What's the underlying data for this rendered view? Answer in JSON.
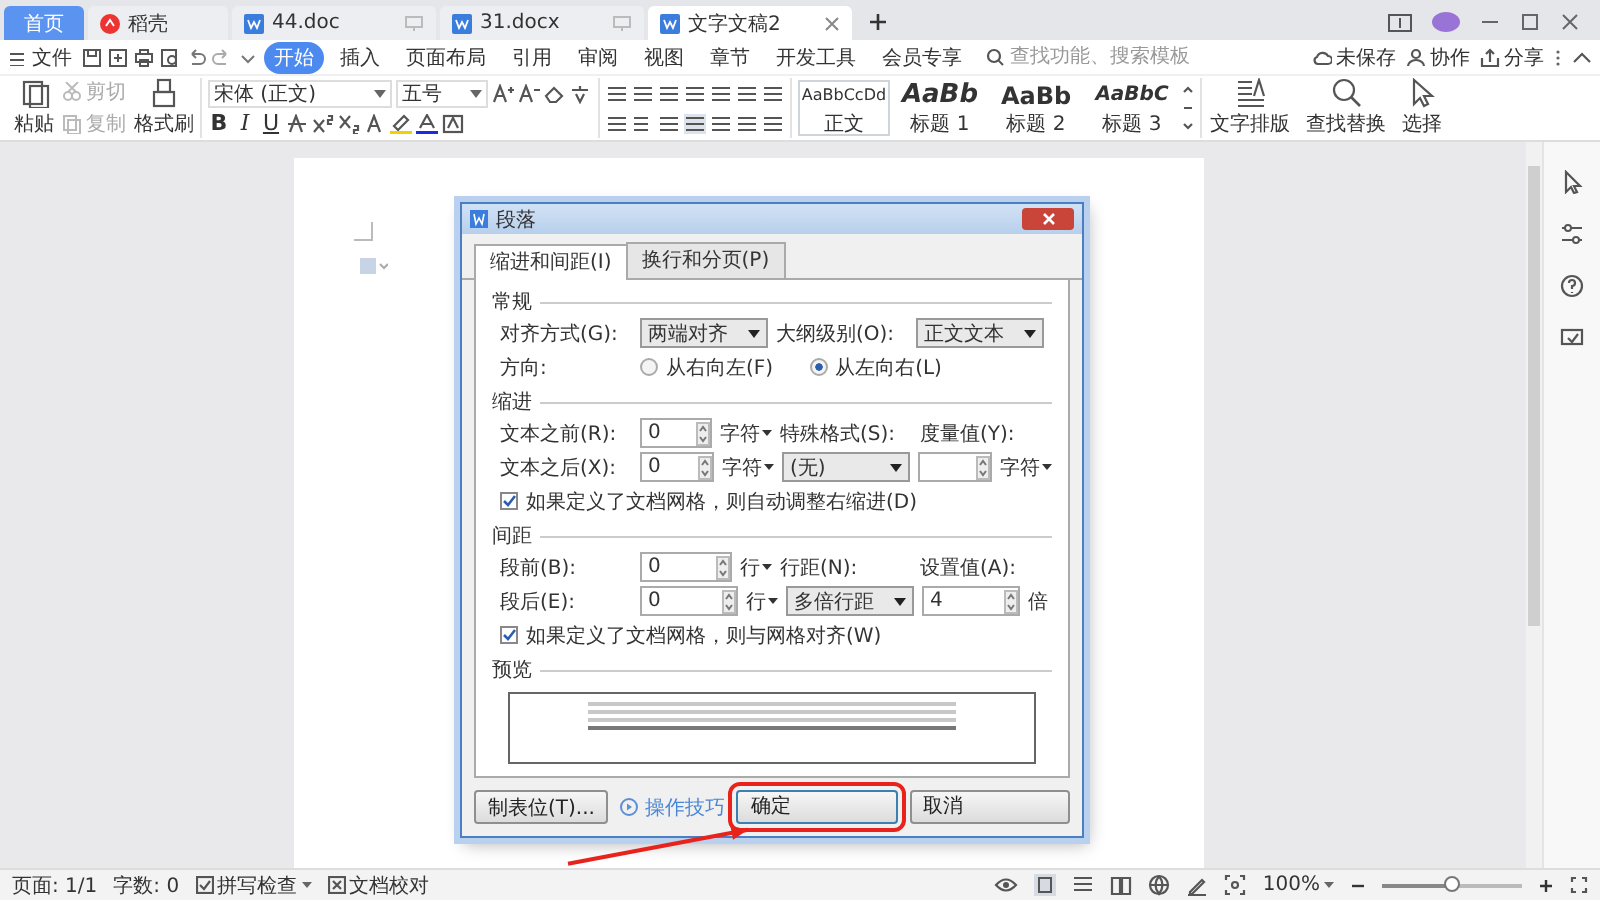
{
  "tab_bar": {
    "tabs": [
      {
        "label": "首页",
        "kind": "home",
        "selected": false
      },
      {
        "label": "稻壳",
        "kind": "docer",
        "selected": false
      },
      {
        "label": "44.doc",
        "kind": "doc",
        "selected": false
      },
      {
        "label": "31.docx",
        "kind": "doc",
        "selected": false
      },
      {
        "label": "文字文稿2",
        "kind": "doc",
        "selected": true
      }
    ]
  },
  "menu_bar": {
    "file": "文件",
    "tabs": [
      {
        "label": "开始",
        "selected": true
      },
      {
        "label": "插入",
        "selected": false
      },
      {
        "label": "页面布局",
        "selected": false
      },
      {
        "label": "引用",
        "selected": false
      },
      {
        "label": "审阅",
        "selected": false
      },
      {
        "label": "视图",
        "selected": false
      },
      {
        "label": "章节",
        "selected": false
      },
      {
        "label": "开发工具",
        "selected": false
      },
      {
        "label": "会员专享",
        "selected": false
      }
    ],
    "search": {
      "placeholder": "查找功能、搜索模板"
    },
    "actions": [
      "未保存",
      "协作",
      "分享"
    ]
  },
  "ribbon": {
    "clipboard": [
      {
        "label": "粘贴",
        "kind": "large",
        "disabled": false
      },
      {
        "label": "剪切",
        "kind": "small",
        "disabled": true
      },
      {
        "label": "复制",
        "kind": "small",
        "disabled": true
      },
      {
        "label": "格式刷",
        "kind": "large",
        "disabled": false
      }
    ],
    "font": {
      "name": "宋体 (正文)",
      "size": "五号",
      "format_buttons": [
        "B",
        "I",
        "U"
      ]
    },
    "styles": [
      {
        "preview": "AaBbCcDd",
        "label": "正文",
        "kind": "body",
        "selected": true
      },
      {
        "preview": "AaBb",
        "label": "标题 1",
        "kind": "h1",
        "selected": false
      },
      {
        "preview": "AaBb",
        "label": "标题 2",
        "kind": "h2",
        "selected": false
      },
      {
        "preview": "AaBbC",
        "label": "标题 3",
        "kind": "h3",
        "selected": false
      }
    ],
    "tools": [
      {
        "label": "文字排版",
        "kind": "layout"
      },
      {
        "label": "查找替换",
        "kind": "find"
      },
      {
        "label": "选择",
        "kind": "select"
      }
    ]
  },
  "dialog": {
    "title": "段落",
    "tabs": [
      {
        "label": "缩进和间距(I)",
        "selected": true
      },
      {
        "label": "换行和分页(P)",
        "selected": false
      }
    ],
    "sections": [
      {
        "title": "常规",
        "kind": "fields",
        "rows": [
          {
            "items": [
              {
                "kind": "label",
                "text": "对齐方式(G):"
              },
              {
                "kind": "select",
                "value": "两端对齐"
              },
              {
                "kind": "label",
                "text": "大纲级别(O):"
              },
              {
                "kind": "select",
                "value": "正文文本"
              }
            ]
          },
          {
            "items": [
              {
                "kind": "label",
                "text": "方向:"
              },
              {
                "kind": "radio",
                "text": "从右向左(F)",
                "checked": false
              },
              {
                "kind": "radio",
                "text": "从左向右(L)",
                "checked": true
              }
            ]
          }
        ]
      },
      {
        "title": "缩进",
        "kind": "fields",
        "rows": [
          {
            "items": [
              {
                "kind": "label",
                "text": "文本之前(R):"
              },
              {
                "kind": "spin",
                "value": "0"
              },
              {
                "kind": "unit",
                "text": "字符",
                "dropdown": true
              },
              {
                "kind": "label",
                "text": "特殊格式(S):"
              },
              {
                "kind": "label",
                "text": "度量值(Y):"
              }
            ]
          },
          {
            "items": [
              {
                "kind": "label",
                "text": "文本之后(X):"
              },
              {
                "kind": "spin",
                "value": "0"
              },
              {
                "kind": "unit",
                "text": "字符",
                "dropdown": true
              },
              {
                "kind": "select",
                "value": "(无)"
              },
              {
                "kind": "spin"
              },
              {
                "kind": "unit",
                "text": "字符",
                "dropdown": true
              }
            ]
          },
          {
            "items": [
              {
                "kind": "checkbox",
                "text": "如果定义了文档网格，则自动调整右缩进(D)",
                "checked": true
              }
            ]
          }
        ]
      },
      {
        "title": "间距",
        "kind": "fields",
        "rows": [
          {
            "items": [
              {
                "kind": "label",
                "text": "段前(B):"
              },
              {
                "kind": "spin",
                "value": "0"
              },
              {
                "kind": "unit",
                "text": "行",
                "dropdown": true
              },
              {
                "kind": "label",
                "text": "行距(N):"
              },
              {
                "kind": "label",
                "text": "设置值(A):"
              }
            ]
          },
          {
            "items": [
              {
                "kind": "label",
                "text": "段后(E):"
              },
              {
                "kind": "spin",
                "value": "0"
              },
              {
                "kind": "unit",
                "text": "行",
                "dropdown": true
              },
              {
                "kind": "select",
                "value": "多倍行距"
              },
              {
                "kind": "spin",
                "value": "4"
              },
              {
                "kind": "unit",
                "text": "倍",
                "dropdown": false
              }
            ]
          },
          {
            "items": [
              {
                "kind": "checkbox",
                "text": "如果定义了文档网格，则与网格对齐(W)",
                "checked": true
              }
            ]
          }
        ]
      },
      {
        "title": "预览",
        "kind": "preview"
      }
    ],
    "footer": {
      "tabs_button": "制表位(T)...",
      "tips_link": "操作技巧",
      "buttons": [
        {
          "label": "确定",
          "highlighted": true
        },
        {
          "label": "取消",
          "highlighted": false
        }
      ]
    }
  },
  "status_bar": {
    "page": "页面: 1/1",
    "words": "字数: 0",
    "spell_check": "拼写检查",
    "proofread": "文档校对",
    "zoom": "100%",
    "zoom_slider": {
      "level": 0.5
    }
  }
}
